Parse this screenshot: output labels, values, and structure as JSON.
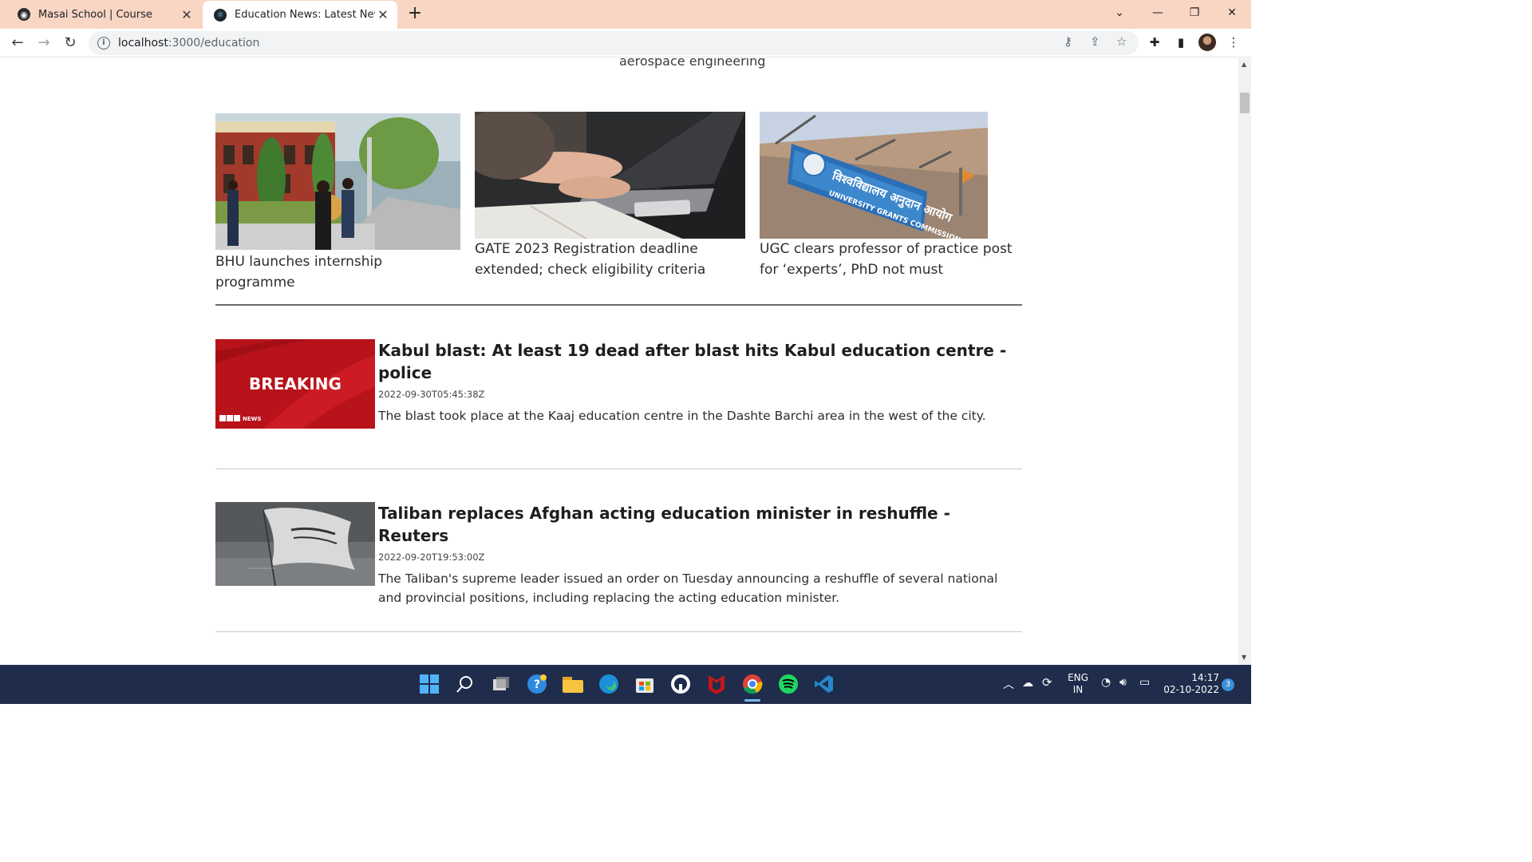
{
  "browser": {
    "tabs": [
      {
        "title": "Masai School | Course",
        "active": false,
        "icon": "globe-icon"
      },
      {
        "title": "Education News: Latest News, Inc",
        "active": true,
        "icon": "react-icon"
      }
    ],
    "new_tab": "+",
    "url_host": "localhost",
    "url_path": ":3000/education"
  },
  "page": {
    "partial_text": "aerospace engineering",
    "top_stories": [
      {
        "caption": "BHU launches internship programme",
        "image": "students walking on campus"
      },
      {
        "caption": "GATE 2023 Registration deadline extended; check eligibility criteria",
        "image": "hands typing on laptop"
      },
      {
        "caption": "UGC clears professor of practice post for ‘experts’, PhD not must",
        "image": "university grants commission sign"
      }
    ],
    "ugc_sign": {
      "hindi": "विश्वविद्यालय अनुदान आयोग",
      "english": "UNIVERSITY GRANTS COMMISSION"
    },
    "articles": [
      {
        "title": "Kabul blast: At least 19 dead after blast hits Kabul education centre - police",
        "date": "2022-09-30T05:45:38Z",
        "description": "The blast took place at the Kaaj education centre in the Dashte Barchi area in the west of the city.",
        "image_text": "BREAKING",
        "image_brand": "BBC NEWS"
      },
      {
        "title": "Taliban replaces Afghan acting education minister in reshuffle - Reuters",
        "date": "2022-09-20T19:53:00Z",
        "description": "The Taliban's supreme leader issued an order on Tuesday announcing a reshuffle of several national and provincial positions, including replacing the acting education minister.",
        "image_text": ""
      }
    ]
  },
  "taskbar": {
    "lang": "ENG",
    "region": "IN",
    "time": "14:17",
    "date": "02-10-2022",
    "notifications": "3"
  }
}
